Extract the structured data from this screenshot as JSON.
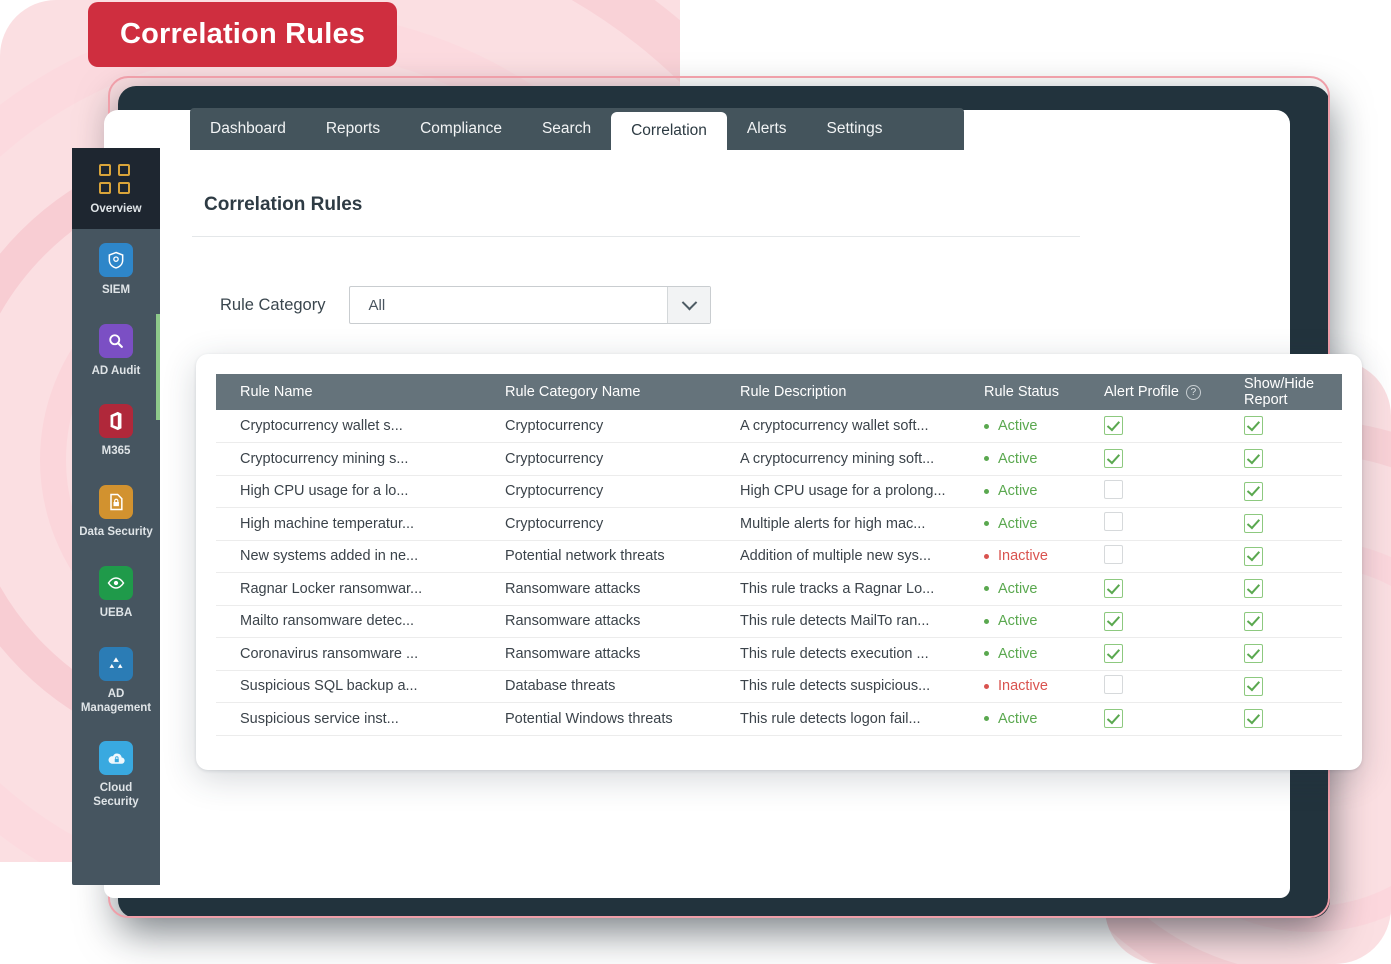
{
  "badge": {
    "label": "Correlation Rules"
  },
  "nav": {
    "tabs": [
      {
        "label": "Dashboard",
        "active": false
      },
      {
        "label": "Reports",
        "active": false
      },
      {
        "label": "Compliance",
        "active": false
      },
      {
        "label": "Search",
        "active": false
      },
      {
        "label": "Correlation",
        "active": true
      },
      {
        "label": "Alerts",
        "active": false
      },
      {
        "label": "Settings",
        "active": false
      }
    ]
  },
  "sidebar": {
    "items": [
      {
        "label": "Overview",
        "icon": "grid-icon",
        "active": true,
        "color": "#d9a43a"
      },
      {
        "label": "SIEM",
        "icon": "shield-icon",
        "active": false,
        "color": "#2e86c9"
      },
      {
        "label": "AD Audit",
        "icon": "magnifier-icon",
        "active": false,
        "color": "#7b4fc4"
      },
      {
        "label": "M365",
        "icon": "office-icon",
        "active": false,
        "color": "#b0283a"
      },
      {
        "label": "Data Security",
        "icon": "file-lock-icon",
        "active": false,
        "color": "#d2922f"
      },
      {
        "label": "UEBA",
        "icon": "eye-scan-icon",
        "active": false,
        "color": "#1f9a4a"
      },
      {
        "label": "AD Management",
        "icon": "people-icon",
        "active": false,
        "color": "#2b7cb5"
      },
      {
        "label": "Cloud Security",
        "icon": "cloud-lock-icon",
        "active": false,
        "color": "#39a9e0"
      }
    ]
  },
  "page": {
    "title": "Correlation Rules",
    "filter_label": "Rule Category",
    "filter_value": "All"
  },
  "table": {
    "headers": {
      "name": "Rule Name",
      "category": "Rule Category Name",
      "description": "Rule Description",
      "status": "Rule Status",
      "alert_profile": "Alert Profile",
      "alert_profile_help": "?",
      "show_hide": "Show/Hide Report"
    },
    "rows": [
      {
        "name": "Cryptocurrency wallet s...",
        "category": "Cryptocurrency",
        "description": "A cryptocurrency wallet soft...",
        "status": "Active",
        "alert_profile": true,
        "show_hide": true
      },
      {
        "name": "Cryptocurrency mining s...",
        "category": "Cryptocurrency",
        "description": "A cryptocurrency mining soft...",
        "status": "Active",
        "alert_profile": true,
        "show_hide": true
      },
      {
        "name": "High CPU usage for a lo...",
        "category": "Cryptocurrency",
        "description": "High CPU usage for a prolong...",
        "status": "Active",
        "alert_profile": false,
        "show_hide": true
      },
      {
        "name": "High machine temperatur...",
        "category": "Cryptocurrency",
        "description": "Multiple alerts for high mac...",
        "status": "Active",
        "alert_profile": false,
        "show_hide": true
      },
      {
        "name": "New systems added in ne...",
        "category": "Potential network threats",
        "description": "Addition of multiple new sys...",
        "status": "Inactive",
        "alert_profile": false,
        "show_hide": true
      },
      {
        "name": "Ragnar Locker ransomwar...",
        "category": "Ransomware attacks",
        "description": "This rule tracks a Ragnar Lo...",
        "status": "Active",
        "alert_profile": true,
        "show_hide": true
      },
      {
        "name": "Mailto ransomware detec...",
        "category": "Ransomware attacks",
        "description": "This rule detects MailTo ran...",
        "status": "Active",
        "alert_profile": true,
        "show_hide": true
      },
      {
        "name": "Coronavirus ransomware ...",
        "category": "Ransomware attacks",
        "description": "This rule detects execution ...",
        "status": "Active",
        "alert_profile": true,
        "show_hide": true
      },
      {
        "name": "Suspicious SQL backup a...",
        "category": "Database threats",
        "description": "This rule detects suspicious...",
        "status": "Inactive",
        "alert_profile": false,
        "show_hide": true
      },
      {
        "name": "Suspicious service inst...",
        "category": "Potential Windows threats",
        "description": "This rule detects logon fail...",
        "status": "Active",
        "alert_profile": true,
        "show_hide": true
      }
    ]
  },
  "colors": {
    "badge_red": "#cf2e3f",
    "nav_bar": "#44545c",
    "sidebar": "#465560",
    "sidebar_active": "#1e2630",
    "table_header": "#65737b",
    "status_active": "#5aa84f",
    "status_inactive": "#d9534f",
    "background_pink": "#fbdfe2"
  }
}
